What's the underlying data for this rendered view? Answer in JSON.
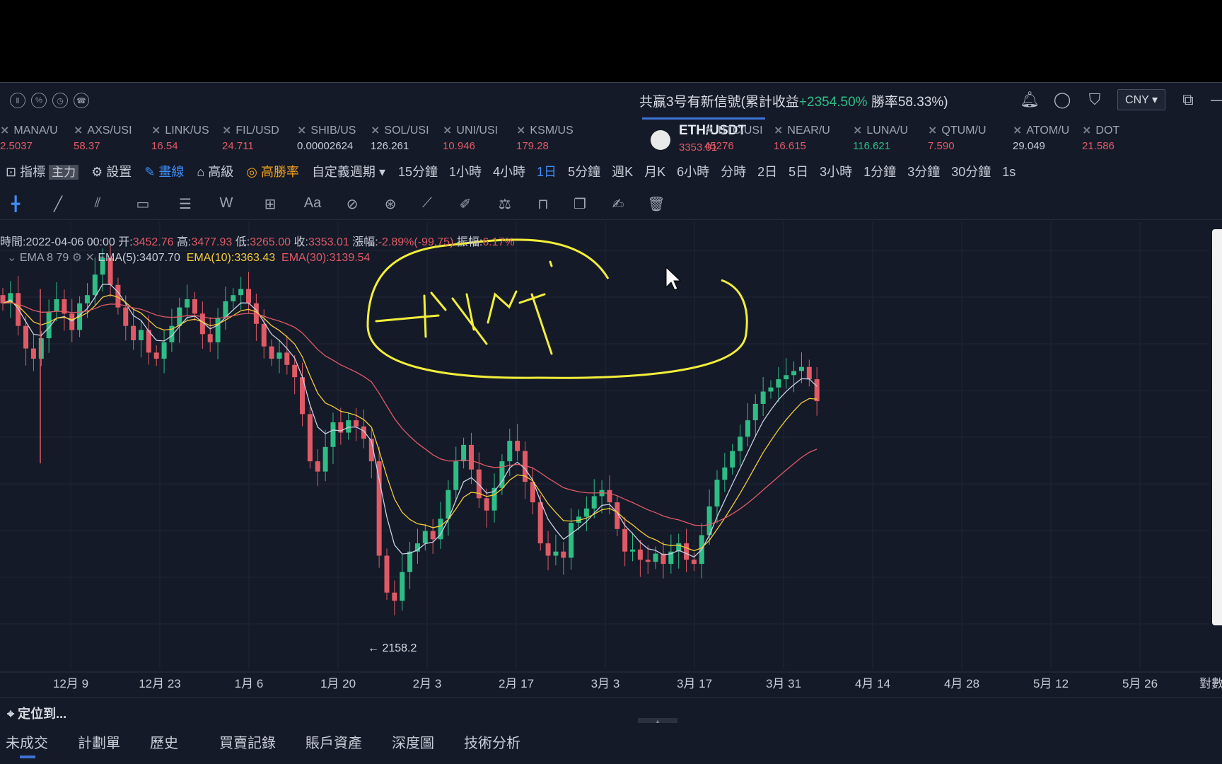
{
  "topbar": {
    "signal_prefix": "共赢3号有新信號(累計收益",
    "signal_gain": "+2354.50%",
    "signal_suffix": " 勝率58.33%)",
    "currency": "CNY ▾",
    "left_icons": [
      "pause-icon",
      "shield-icon",
      "speed-icon",
      "phone-icon"
    ]
  },
  "tickers": [
    {
      "symbol": "MANA/U",
      "price": "2.5037",
      "color": "#e05a66"
    },
    {
      "symbol": "AXS/USI",
      "price": "58.37",
      "color": "#e05a66"
    },
    {
      "symbol": "LINK/US",
      "price": "16.54",
      "color": "#e05a66"
    },
    {
      "symbol": "FIL/USD",
      "price": "24.711",
      "color": "#e05a66"
    },
    {
      "symbol": "SHIB/US",
      "price": "0.00002624",
      "color": "#c8ccd6"
    },
    {
      "symbol": "SOL/USI",
      "price": "126.261",
      "color": "#c8ccd6"
    },
    {
      "symbol": "UNI/USI",
      "price": "10.946",
      "color": "#e05a66"
    },
    {
      "symbol": "KSM/US",
      "price": "179.28",
      "color": "#e05a66"
    },
    {
      "symbol": "ETH/USDT",
      "price": "3353.01",
      "color": "#e05a66",
      "active": true
    },
    {
      "symbol": "BTC/USI",
      "price": "45276",
      "color": "#e05a66"
    },
    {
      "symbol": "NEAR/U",
      "price": "16.615",
      "color": "#e05a66"
    },
    {
      "symbol": "LUNA/U",
      "price": "116.621",
      "color": "#2ebd85"
    },
    {
      "symbol": "QTUM/U",
      "price": "7.590",
      "color": "#e05a66"
    },
    {
      "symbol": "ATOM/U",
      "price": "29.049",
      "color": "#c8ccd6"
    },
    {
      "symbol": "DOT",
      "price": "21.586",
      "color": "#e05a66"
    }
  ],
  "toolbar": {
    "indicators": "指標",
    "main": "主力",
    "settings": "設置",
    "draw": "畫線",
    "advanced": "高級",
    "winrate": "高勝率",
    "custom_period": "自定義週期 ▾",
    "periods": [
      "15分鐘",
      "1小時",
      "4小時",
      "1日",
      "5分鐘",
      "週K",
      "月K",
      "6小時",
      "分時",
      "2日",
      "5日",
      "3小時",
      "1分鐘",
      "3分鐘",
      "30分鐘",
      "1s"
    ],
    "active_period": "1日"
  },
  "ohlc": {
    "time_label": "時間:",
    "time": "2022-04-06 00:00",
    "open_label": "开:",
    "open": "3452.76",
    "high_label": "高:",
    "high": "3477.93",
    "low_label": "低:",
    "low": "3265.00",
    "close_label": "收:",
    "close": "3353.01",
    "change_label": "漲幅:",
    "change": "-2.89%(-99.75)",
    "amp_label": "振幅:",
    "amp": "6.17%"
  },
  "ema": {
    "name": "EMA 8 79",
    "e5": "EMA(5):3407.70",
    "e10": "EMA(10):3363.43",
    "e30": "EMA(30):3139.54"
  },
  "chart_data": {
    "type": "candlestick",
    "x_ticks": [
      "12月 9",
      "12月 23",
      "1月 6",
      "1月 20",
      "2月 3",
      "2月 17",
      "3月 3",
      "3月 17",
      "3月 31",
      "4月 14",
      "4月 28",
      "5月 12",
      "5月 26"
    ],
    "right_label": "對數",
    "low_marker": "← 2158.2",
    "series": [
      {
        "name": "EMA(5)",
        "color": "#c9cfe4"
      },
      {
        "name": "EMA(10)",
        "color": "#f4cd3a"
      },
      {
        "name": "EMA(30)",
        "color": "#e05a66"
      }
    ],
    "closes": [
      3830,
      3880,
      3720,
      3610,
      3560,
      3660,
      3790,
      3850,
      3780,
      3700,
      3830,
      3870,
      3970,
      4050,
      3920,
      3810,
      3720,
      3650,
      3700,
      3590,
      3560,
      3640,
      3720,
      3810,
      3850,
      3780,
      3680,
      3640,
      3760,
      3840,
      3870,
      3900,
      3830,
      3730,
      3620,
      3560,
      3590,
      3530,
      3470,
      3290,
      3060,
      3010,
      3130,
      3250,
      3200,
      3260,
      3230,
      3170,
      3060,
      2600,
      2420,
      2380,
      2520,
      2620,
      2660,
      2720,
      2680,
      2780,
      2920,
      3060,
      3140,
      3020,
      2880,
      2820,
      2930,
      3060,
      3160,
      3110,
      2960,
      2860,
      2660,
      2600,
      2620,
      2590,
      2760,
      2790,
      2830,
      2890,
      2920,
      2860,
      2730,
      2620,
      2630,
      2580,
      2570,
      2610,
      2560,
      2620,
      2660,
      2580,
      2560,
      2700,
      2840,
      2970,
      3030,
      3110,
      3180,
      3260,
      3340,
      3400,
      3420,
      3460,
      3480,
      3500,
      3520,
      3460,
      3353
    ]
  },
  "status": {
    "locate": "定位到..."
  },
  "tabs": [
    "未成交",
    "計劃單",
    "歷史",
    "買賣記錄",
    "賬戶資產",
    "深度圖",
    "技術分析"
  ],
  "drawing_text": "问题4",
  "colors": {
    "up": "#2ebd85",
    "down": "#e05a66",
    "accent": "#3e74d8",
    "annotation": "#f2ee3a"
  }
}
